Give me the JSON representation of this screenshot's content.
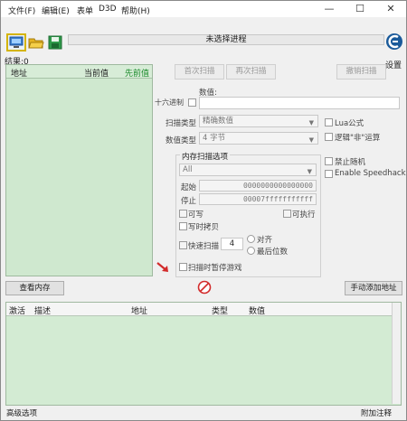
{
  "menu": [
    "文件(F)",
    "编辑(E)",
    "表单",
    "D3D",
    "帮助(H)"
  ],
  "window_controls": [
    "—",
    "☐",
    "✕"
  ],
  "toolbar": {
    "process_label": "未选择进程",
    "settings_label": "设置"
  },
  "results_label": "结果:0",
  "found_list": {
    "headers": [
      "地址",
      "当前值",
      "先前值"
    ]
  },
  "scan_buttons": {
    "first": "首次扫描",
    "next": "再次扫描",
    "undo": "撤销扫描"
  },
  "value_label": "数值:",
  "hex_label": "十六进制",
  "scan_type": {
    "label": "扫描类型",
    "value": "精确数值"
  },
  "value_type": {
    "label": "数值类型",
    "value": "4 字节"
  },
  "options": {
    "lua": "Lua公式",
    "logic": "逻辑\"非\"运算",
    "no_random": "禁止随机",
    "speedhack": "Enable Speedhack"
  },
  "memory": {
    "title": "内存扫描选项",
    "region": "All",
    "start_label": "起始",
    "start_value": "0000000000000000",
    "stop_label": "停止",
    "stop_value": "00007fffffffffff",
    "writable": "可写",
    "executable": "可执行",
    "copy_on_write": "写时拷贝",
    "fast_scan": "快速扫描",
    "fast_scan_value": "4",
    "align": "对齐",
    "last_digits": "最后位数",
    "pause_game": "扫描时暂停游戏"
  },
  "view_memory": "查看内存",
  "add_manual": "手动添加地址",
  "address_table": {
    "headers": [
      "激活",
      "描述",
      "地址",
      "类型",
      "数值"
    ]
  },
  "footer": {
    "advanced": "高级选项",
    "table_extras": "附加注释"
  },
  "colors": {
    "green_list": "#cfe8cf",
    "accent_red": "#d22b2b"
  },
  "icons": [
    "computer-icon",
    "open-folder-icon",
    "save-disk-icon",
    "settings-logo-icon",
    "red-arrow-icon",
    "stop-sign-icon"
  ]
}
